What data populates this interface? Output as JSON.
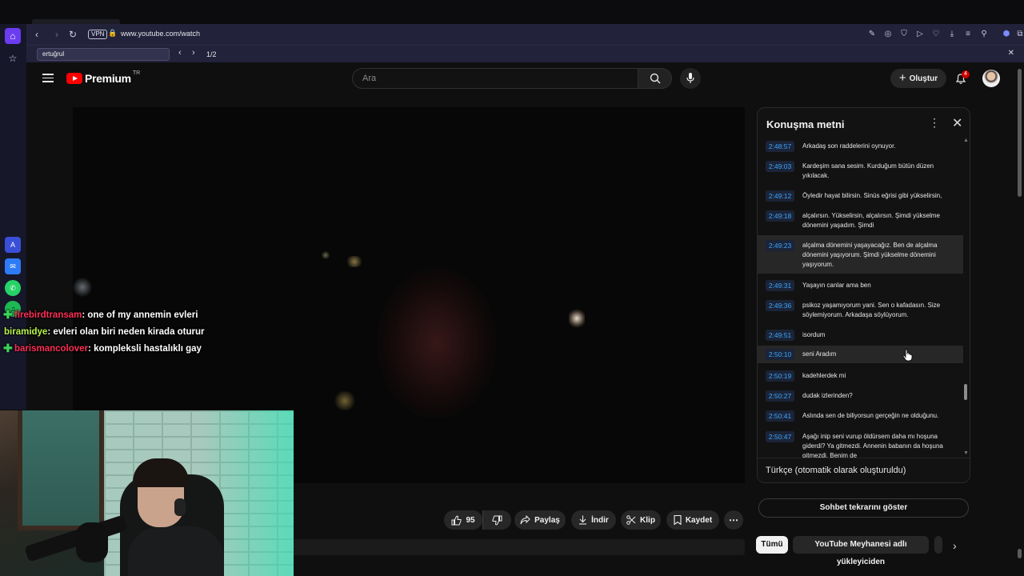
{
  "browser": {
    "url": "www.youtube.com/watch",
    "vpn_label": "VPN",
    "find_query": "ertuğrul",
    "find_count": "1/2"
  },
  "youtube": {
    "logo_text": "Premium",
    "logo_region": "TR",
    "search_placeholder": "Ara",
    "create_label": "Oluştur",
    "notification_count": "4"
  },
  "actions": {
    "like_count": "95",
    "share_label": "Paylaş",
    "download_label": "İndir",
    "clip_label": "Klip",
    "save_label": "Kaydet"
  },
  "transcript": {
    "title": "Konuşma metni",
    "language": "Türkçe (otomatik olarak oluşturuldu)",
    "segments": [
      {
        "time": "2:48:57",
        "text": "Arkadaş son raddelerini oynuyor."
      },
      {
        "time": "2:49:03",
        "text": "Kardeşim sana sesim. Kurduğum bütün düzen yıkılacak."
      },
      {
        "time": "2:49:12",
        "text": "Öyledir hayat bilirsin. Sinüs eğrisi gibi yükselirsin,"
      },
      {
        "time": "2:49:18",
        "text": "alçalırsın. Yükselirsin, alçalırsın. Şimdi yükselme dönemini yaşadım. Şimdi"
      },
      {
        "time": "2:49:23",
        "text": "alçalma dönemini yaşayacağız. Ben de alçalma dönemini yaşıyorum. Şimdi yükselme dönemini yaşıyorum."
      },
      {
        "time": "2:49:31",
        "text": "Yaşayın canlar ama ben"
      },
      {
        "time": "2:49:36",
        "text": "psikoz yaşamıyorum yani. Sen o kafadasın. Size söylemiyorum. Arkadaşa söylüyorum."
      },
      {
        "time": "2:49:51",
        "text": "isordum"
      },
      {
        "time": "2:50:10",
        "text": "seni Aradım"
      },
      {
        "time": "2:50:19",
        "text": "kadehlerdek mi"
      },
      {
        "time": "2:50:27",
        "text": "dudak izlerinden?"
      },
      {
        "time": "2:50:41",
        "text": "Aslında sen de biliyorsun gerçeğin ne olduğunu."
      },
      {
        "time": "2:50:47",
        "text": "Aşağı inip seni vurup öldürsem daha mı hoşuna giderdi? Ya gitmezdi. Annenin babanın da hoşuna gitmezdi. Benim de"
      }
    ]
  },
  "below_panel": {
    "replay_label": "Sohbet tekrarını göster",
    "chips": [
      "Tümü",
      "YouTube Meyhanesi adlı yükleyiciden"
    ]
  },
  "chat": [
    {
      "user": "firebirdtransam",
      "message": ": one of my annemin evleri",
      "user_color": "#ff2d55"
    },
    {
      "user": "biramidye",
      "message": ": evleri olan biri neden kirada oturur",
      "user_color": "#b7f34a"
    },
    {
      "user": "barismancolover",
      "message": ": kompleksli hastalıklı gay",
      "user_color": "#ff2d55"
    }
  ]
}
